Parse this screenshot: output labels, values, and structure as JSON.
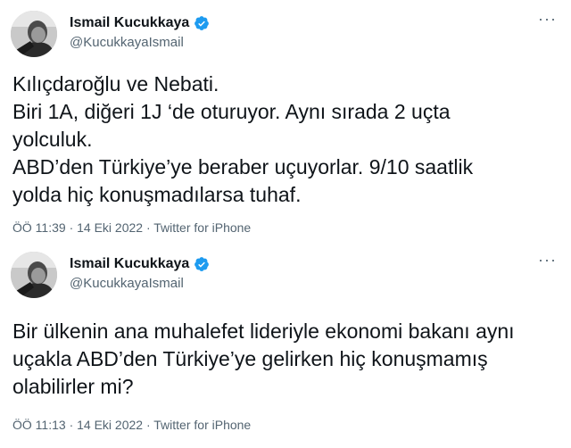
{
  "colors": {
    "verified_badge": "#1d9bf0",
    "secondary_text": "#536471",
    "primary_text": "#0f1419"
  },
  "tweets": [
    {
      "author_name": "Ismail Kucukkaya",
      "handle": "@KucukkayaIsmail",
      "more_icon": "···",
      "lines": [
        "Kılıçdaroğlu ve Nebati.",
        "Biri 1A, diğeri 1J ‘de oturuyor. Aynı sırada 2 uçta",
        "yolculuk.",
        "ABD’den Türkiye’ye beraber uçuyorlar. 9/10 saatlik",
        "yolda hiç konuşmadılarsa tuhaf."
      ],
      "time": "ÖÖ 11:39",
      "date": "14 Eki 2022",
      "separator": "·",
      "source": "Twitter for iPhone"
    },
    {
      "author_name": "Ismail Kucukkaya",
      "handle": "@KucukkayaIsmail",
      "more_icon": "···",
      "lines": [
        "Bir ülkenin ana muhalefet lideriyle ekonomi bakanı aynı",
        "uçakla ABD’den Türkiye’ye gelirken hiç konuşmamış",
        "olabilirler mi?"
      ],
      "time": "ÖÖ 11:13",
      "date": "14 Eki 2022",
      "separator": "·",
      "source": "Twitter for iPhone"
    }
  ]
}
